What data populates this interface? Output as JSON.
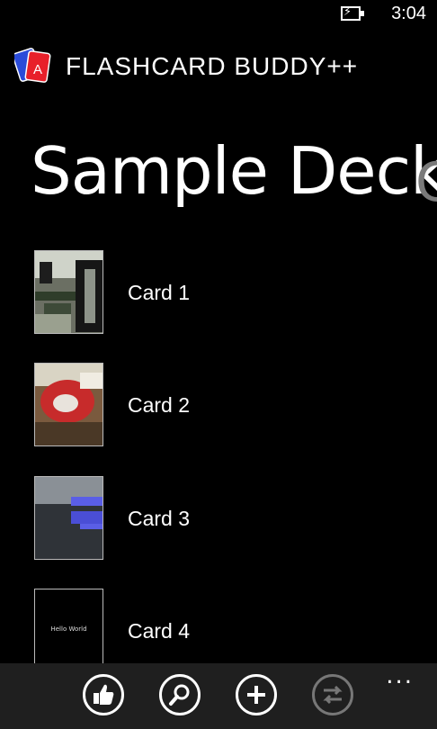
{
  "status_bar": {
    "time": "3:04"
  },
  "header": {
    "app_title": "FLASHCARD BUDDY++",
    "logo_letter": "A"
  },
  "page": {
    "title": "Sample Deck",
    "next_title_peek": "C"
  },
  "cards": [
    {
      "label": "Card 1"
    },
    {
      "label": "Card 2"
    },
    {
      "label": "Card 3"
    },
    {
      "label": "Card 4",
      "thumbnail_text": "Hello World"
    }
  ],
  "app_bar": {
    "buttons": [
      {
        "icon": "thumbs-up-icon"
      },
      {
        "icon": "search-icon"
      },
      {
        "icon": "add-icon"
      },
      {
        "icon": "swap-icon",
        "disabled": true
      }
    ],
    "more": "..."
  }
}
